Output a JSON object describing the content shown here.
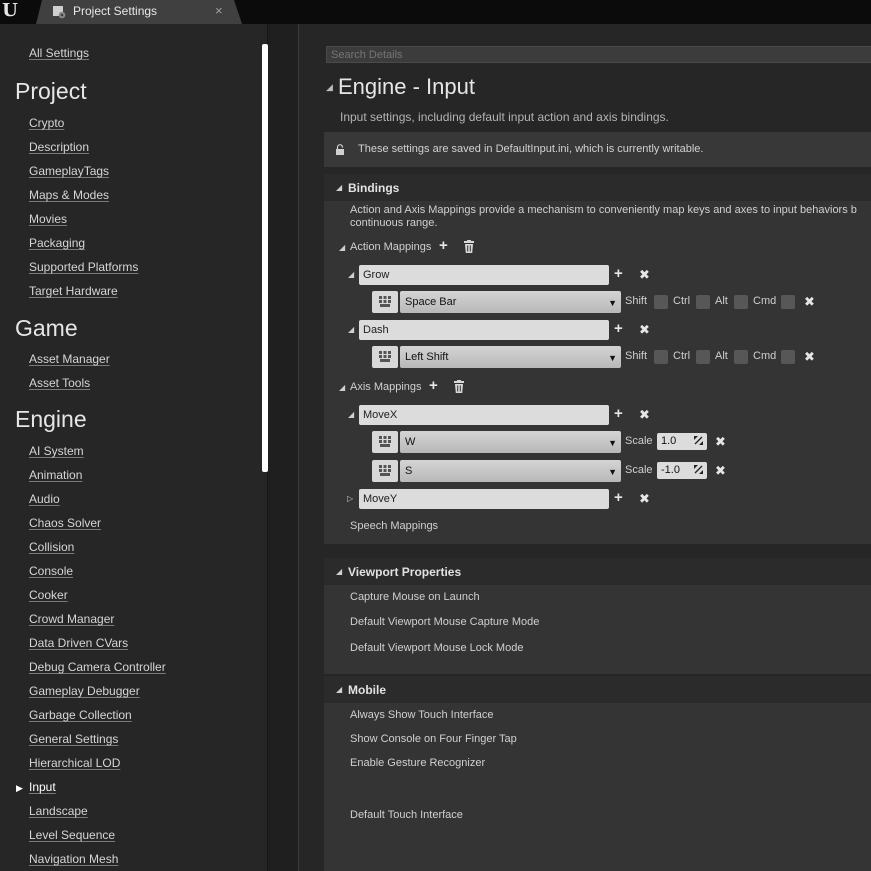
{
  "window": {
    "logo": "U",
    "tab_label": "Project Settings",
    "tab_close": "×"
  },
  "sidebar": {
    "all_settings": "All Settings",
    "sections": [
      {
        "header": "Project",
        "items": [
          "Crypto",
          "Description",
          "GameplayTags",
          "Maps & Modes",
          "Movies",
          "Packaging",
          "Supported Platforms",
          "Target Hardware"
        ]
      },
      {
        "header": "Game",
        "items": [
          "Asset Manager",
          "Asset Tools"
        ]
      },
      {
        "header": "Engine",
        "items": [
          "AI System",
          "Animation",
          "Audio",
          "Chaos Solver",
          "Collision",
          "Console",
          "Cooker",
          "Crowd Manager",
          "Data Driven CVars",
          "Debug Camera Controller",
          "Gameplay Debugger",
          "Garbage Collection",
          "General Settings",
          "Hierarchical LOD",
          "Input",
          "Landscape",
          "Level Sequence",
          "Navigation Mesh"
        ]
      }
    ],
    "active_item": "Input"
  },
  "main": {
    "search_placeholder": "Search Details",
    "title": "Engine - Input",
    "description": "Input settings, including default input action and axis bindings.",
    "notice": "These settings are saved in DefaultInput.ini, which is currently writable.",
    "bindings": {
      "title": "Bindings",
      "description_line1": "Action and Axis Mappings provide a mechanism to conveniently map keys and axes to input behaviors b",
      "description_line2": "continuous range.",
      "action_mappings_label": "Action Mappings",
      "axis_mappings_label": "Axis Mappings",
      "speech_mappings_label": "Speech Mappings",
      "modifiers": [
        "Shift",
        "Ctrl",
        "Alt",
        "Cmd"
      ],
      "scale_label": "Scale",
      "actions": [
        {
          "name": "Grow",
          "key": "Space Bar"
        },
        {
          "name": "Dash",
          "key": "Left Shift"
        }
      ],
      "axes": [
        {
          "name": "MoveX",
          "keys": [
            {
              "key": "W",
              "scale": "1.0"
            },
            {
              "key": "S",
              "scale": "-1.0"
            }
          ]
        },
        {
          "name": "MoveY",
          "collapsed": true
        }
      ]
    },
    "viewport": {
      "title": "Viewport Properties",
      "props": [
        "Capture Mouse on Launch",
        "Default Viewport Mouse Capture Mode",
        "Default Viewport Mouse Lock Mode"
      ]
    },
    "mobile": {
      "title": "Mobile",
      "props": [
        "Always Show Touch Interface",
        "Show Console on Four Finger Tap",
        "Enable Gesture Recognizer",
        "Default Touch Interface"
      ]
    }
  },
  "colors": {
    "background": "#262626",
    "section_header": "#2b2b2b",
    "section_body": "#343434",
    "text": "#d0d0d0"
  },
  "icons": [
    "unreal-logo-icon",
    "settings-icon",
    "close-icon",
    "lock-icon",
    "add-icon",
    "trash-icon",
    "keyboard-icon",
    "dropdown-caret-icon",
    "delete-icon",
    "expand-arrow-icon",
    "collapse-arrow-icon"
  ]
}
